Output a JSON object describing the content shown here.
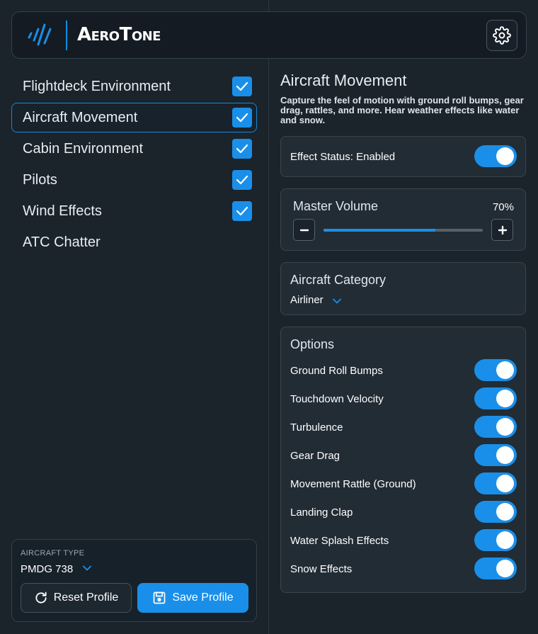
{
  "app": {
    "name": "AeroTone"
  },
  "sidebar": {
    "items": [
      {
        "label": "Flightdeck Environment",
        "checked": true
      },
      {
        "label": "Aircraft Movement",
        "checked": true,
        "active": true
      },
      {
        "label": "Cabin Environment",
        "checked": true
      },
      {
        "label": "Pilots",
        "checked": true
      },
      {
        "label": "Wind Effects",
        "checked": true
      },
      {
        "label": "ATC Chatter",
        "checked": false
      }
    ]
  },
  "footer": {
    "aircraft_type_label": "AIRCRAFT TYPE",
    "aircraft_type_value": "PMDG 738",
    "reset_label": "Reset Profile",
    "save_label": "Save Profile"
  },
  "section": {
    "title": "Aircraft Movement",
    "description": "Capture the feel of motion with ground roll bumps, gear drag, rattles, and more. Hear weather effects like water and snow.",
    "effect_status_label": "Effect Status: Enabled",
    "effect_enabled": true,
    "master_volume": {
      "label": "Master Volume",
      "value_text": "70%",
      "level": 0.7
    },
    "category": {
      "label": "Aircraft Category",
      "value": "Airliner"
    },
    "options": {
      "title": "Options",
      "items": [
        {
          "label": "Ground Roll Bumps",
          "on": true
        },
        {
          "label": "Touchdown Velocity",
          "on": true
        },
        {
          "label": "Turbulence",
          "on": true
        },
        {
          "label": "Gear Drag",
          "on": true
        },
        {
          "label": "Movement Rattle (Ground)",
          "on": true
        },
        {
          "label": "Landing Clap",
          "on": true
        },
        {
          "label": "Water Splash Effects",
          "on": true
        },
        {
          "label": "Snow Effects",
          "on": true
        }
      ]
    }
  },
  "colors": {
    "accent": "#1a8fe9",
    "background": "#1b232b",
    "card": "#222c35"
  }
}
